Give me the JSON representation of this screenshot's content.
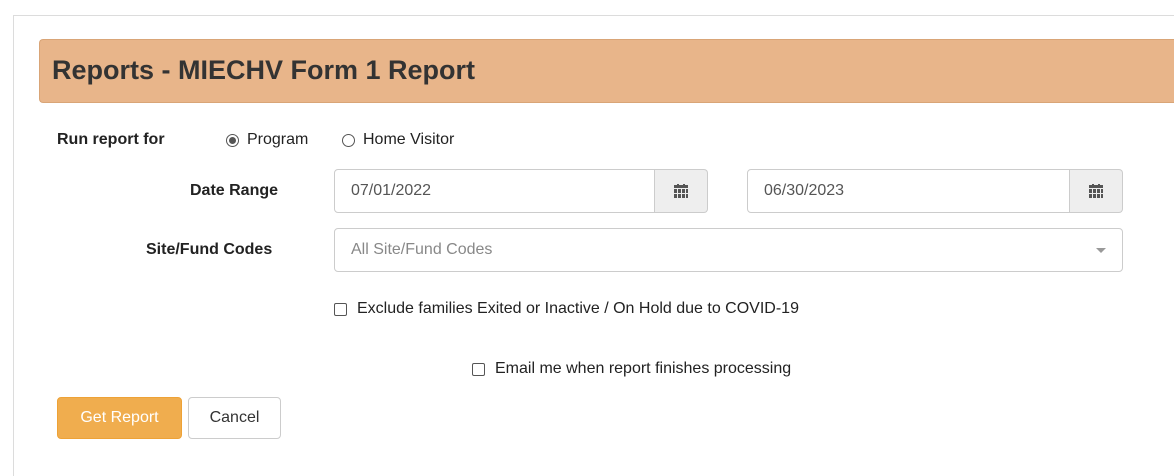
{
  "header": {
    "title": "Reports - MIECHV Form 1 Report"
  },
  "run_report": {
    "label": "Run report for",
    "options": [
      {
        "label": "Program",
        "selected": true
      },
      {
        "label": "Home Visitor",
        "selected": false
      }
    ]
  },
  "date_range": {
    "label": "Date Range",
    "start": "07/01/2022",
    "end": "06/30/2023",
    "icon": "calendar-icon"
  },
  "site_fund": {
    "label": "Site/Fund Codes",
    "placeholder": "All Site/Fund Codes",
    "icon": "caret-down-icon"
  },
  "options": {
    "exclude_label": "Exclude families Exited or Inactive / On Hold due to COVID-19",
    "exclude_checked": false,
    "email_label": "Email me when report finishes processing",
    "email_checked": false
  },
  "buttons": {
    "get_report": "Get Report",
    "cancel": "Cancel"
  },
  "colors": {
    "header_bg": "#e8b58a",
    "primary_button": "#f0ad4e"
  }
}
